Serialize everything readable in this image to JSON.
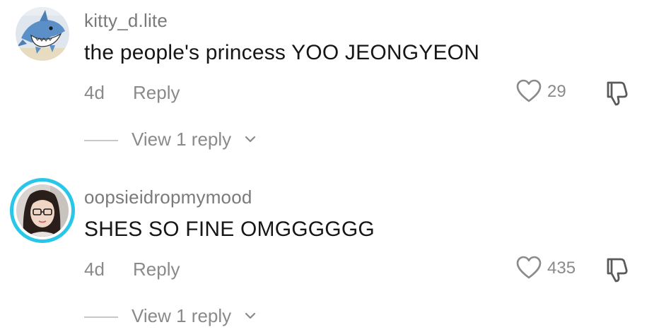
{
  "comments": [
    {
      "username": "kitty_d.lite",
      "text": "the people's princess YOO JEONGYEON",
      "time": "4d",
      "reply_label": "Reply",
      "likes": "29",
      "view_replies_label": "View 1 reply",
      "avatar_icon": "shark-avatar",
      "has_story_ring": false
    },
    {
      "username": "oopsieidropmymood",
      "text": "SHES SO FINE OMGGGGGG",
      "time": "4d",
      "reply_label": "Reply",
      "likes": "435",
      "view_replies_label": "View 1 reply",
      "avatar_icon": "person-photo-avatar",
      "has_story_ring": true
    }
  ],
  "colors": {
    "story_ring": "#28c7e8",
    "secondary_text": "#8a8a8a",
    "primary_text": "#161616"
  }
}
